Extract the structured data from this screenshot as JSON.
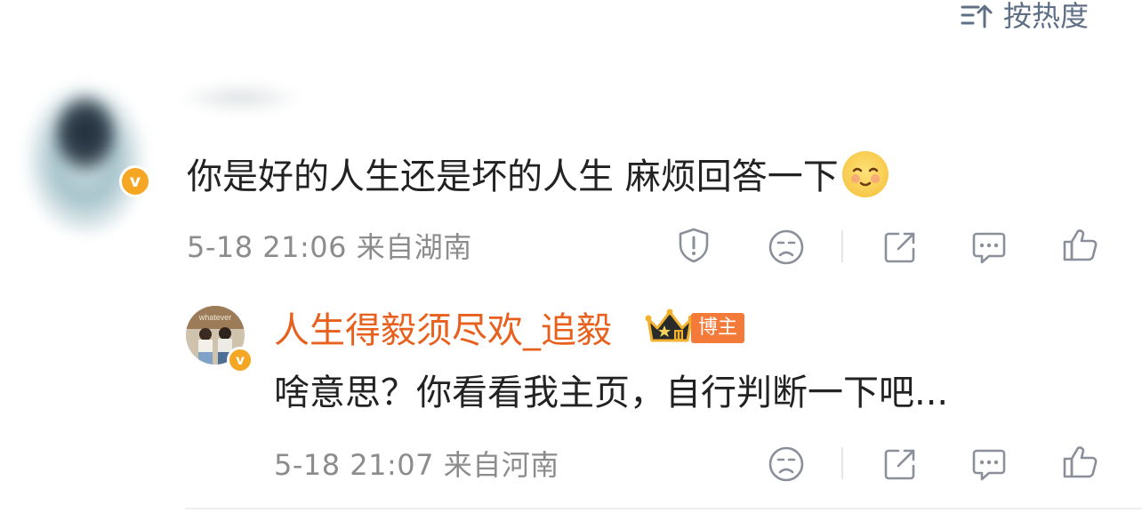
{
  "sort": {
    "label": "按热度",
    "icon": "sort-icon"
  },
  "comment": {
    "text": "你是好的人生还是坏的人生   麻烦回答一下",
    "emoji": "blush-emoji",
    "badge": "v",
    "meta": "5-18 21:06 来自湖南",
    "actions": [
      "report-icon",
      "dislike-icon",
      "share-icon",
      "comment-icon",
      "like-icon"
    ]
  },
  "reply": {
    "username": "人生得毅须尽欢_追毅",
    "role_badge": "博主",
    "avatar_caption": "whatever",
    "badge": "v",
    "text": "啥意思？你看看我主页，自行判断一下吧...",
    "meta": "5-18 21:07 来自河南",
    "actions": [
      "dislike-icon",
      "share-icon",
      "comment-icon",
      "like-icon"
    ]
  },
  "colors": {
    "username": "#e8601d",
    "badge": "#f5a623",
    "icon": "#8a8f99",
    "meta": "#8c8c8c"
  }
}
